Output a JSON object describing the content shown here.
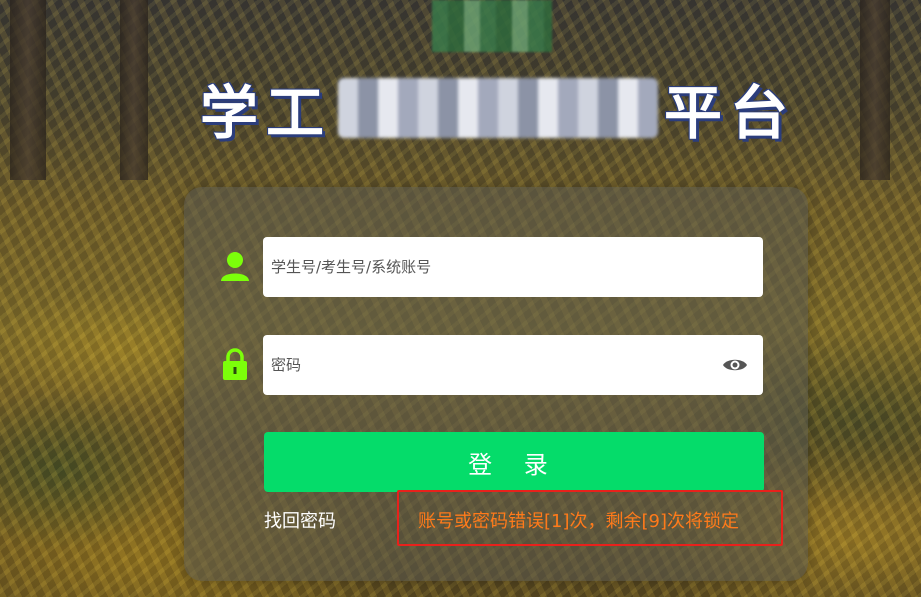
{
  "header": {
    "title_start": "学工",
    "title_end": "平台"
  },
  "login": {
    "username_placeholder": "学生号/考生号/系统账号",
    "password_placeholder": "密码",
    "login_button_label": "登 录",
    "forgot_password_label": "找回密码",
    "error_message": "账号或密码错误[1]次，剩余[9]次将锁定"
  },
  "icons": {
    "user": "user-icon",
    "lock": "lock-icon",
    "eye": "eye-icon"
  },
  "colors": {
    "icon_green": "#7cff0a",
    "button_green": "#05dc6a",
    "error_orange": "#ff7a1a",
    "highlight_red": "#e8211c"
  }
}
